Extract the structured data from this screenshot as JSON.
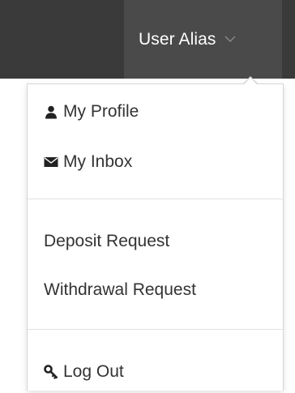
{
  "header": {
    "user_alias": "User Alias",
    "chevron_icon": "chevron-down-icon"
  },
  "menu": {
    "items": [
      {
        "label": "My Profile",
        "icon": "user-icon"
      },
      {
        "label": "My Inbox",
        "icon": "envelope-icon"
      },
      {
        "label": "Deposit Request"
      },
      {
        "label": "Withdrawal Request"
      },
      {
        "label": "Log Out",
        "icon": "key-icon"
      }
    ]
  },
  "colors": {
    "topbar": "#3a3a3a",
    "toggle": "#4a4a4a",
    "menu_text": "#333333",
    "divider": "#e2e2e2"
  }
}
